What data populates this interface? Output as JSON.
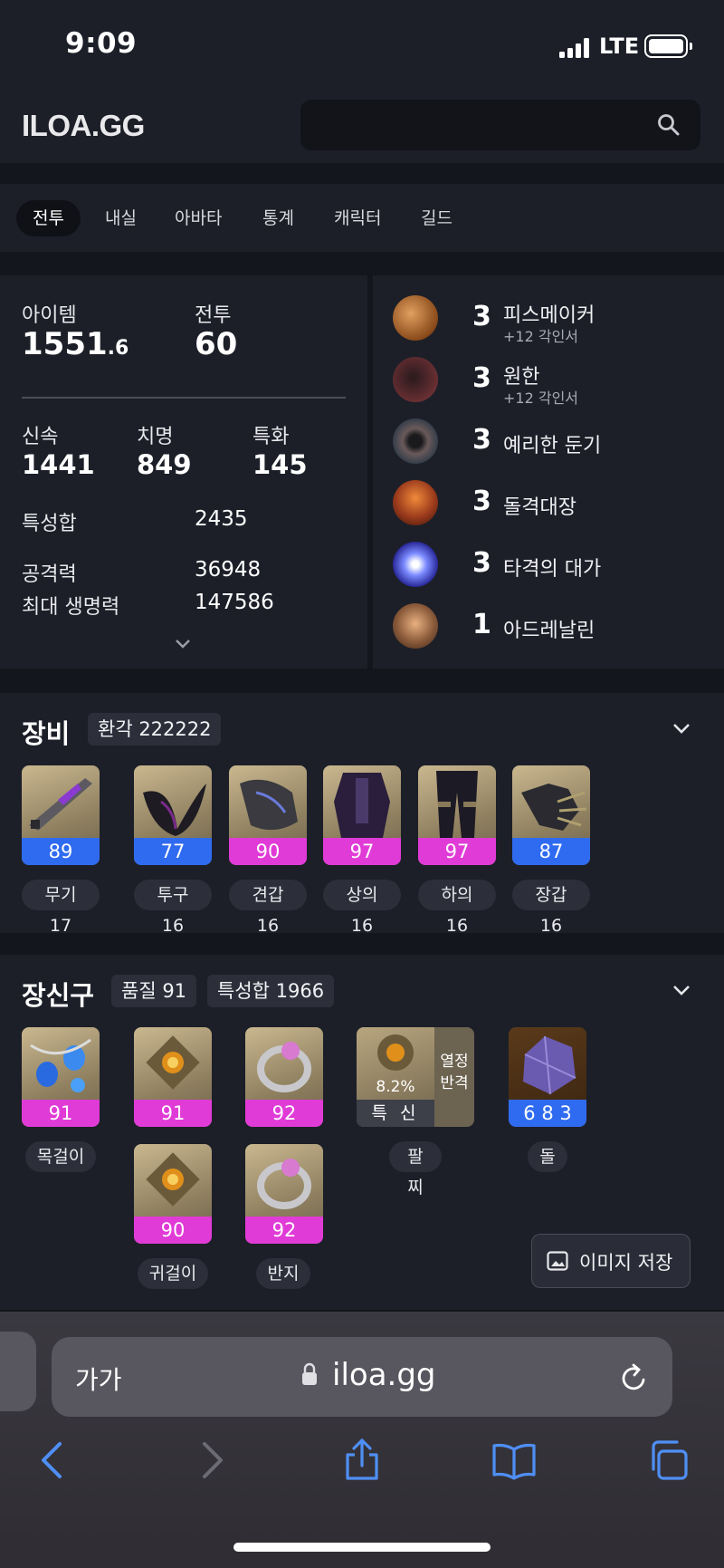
{
  "status": {
    "time": "9:09",
    "network": "LTE"
  },
  "header": {
    "logo": "ILOA.GG",
    "search_placeholder": ""
  },
  "tabs": [
    {
      "label": "전투",
      "active": true
    },
    {
      "label": "내실",
      "active": false
    },
    {
      "label": "아바타",
      "active": false
    },
    {
      "label": "통계",
      "active": false
    },
    {
      "label": "캐릭터",
      "active": false
    },
    {
      "label": "길드",
      "active": false
    }
  ],
  "profile": {
    "item_label": "아이템",
    "item_level_int": "1551",
    "item_level_dec": ".6",
    "combat_label": "전투",
    "combat_level": "60",
    "swift_label": "신속",
    "swift": "1441",
    "crit_label": "치명",
    "crit": "849",
    "spec_label": "특화",
    "spec": "145",
    "stat_total_label": "특성합",
    "stat_total": "2435",
    "attack_label": "공격력",
    "attack": "36948",
    "hp_label": "최대 생명력",
    "hp": "147586"
  },
  "engravings": [
    {
      "level": "3",
      "name": "피스메이커",
      "sub": "+12 각인서",
      "color": "#b86a2a"
    },
    {
      "level": "3",
      "name": "원한",
      "sub": "+12 각인서",
      "color": "#5a2a2e"
    },
    {
      "level": "3",
      "name": "예리한 둔기",
      "sub": "",
      "color": "#3e3a3c"
    },
    {
      "level": "3",
      "name": "돌격대장",
      "sub": "",
      "color": "#9a3a1c"
    },
    {
      "level": "3",
      "name": "타격의 대가",
      "sub": "",
      "color": "#4a52c8"
    },
    {
      "level": "1",
      "name": "아드레날린",
      "sub": "",
      "color": "#8a5a3a"
    }
  ],
  "equipment": {
    "title": "장비",
    "badge": "환각 222222",
    "items": [
      {
        "quality": "89",
        "tier": "blue",
        "label": "무기 17"
      },
      {
        "quality": "77",
        "tier": "blue",
        "label": "투구 16"
      },
      {
        "quality": "90",
        "tier": "pink",
        "label": "견갑 16"
      },
      {
        "quality": "97",
        "tier": "pink",
        "label": "상의 16"
      },
      {
        "quality": "97",
        "tier": "pink",
        "label": "하의 16"
      },
      {
        "quality": "87",
        "tier": "blue",
        "label": "장갑 16"
      }
    ]
  },
  "accessories": {
    "title": "장신구",
    "badge_quality": "품질 91",
    "badge_stat": "특성합 1966",
    "necklace": {
      "quality": "91",
      "label": "목걸이"
    },
    "earring1": {
      "quality": "91"
    },
    "ring1": {
      "quality": "92"
    },
    "earring2": {
      "quality": "90",
      "label": "귀걸이"
    },
    "ring2": {
      "quality": "92",
      "label": "반지"
    },
    "bracelet": {
      "pct": "8.2%",
      "stats": "특 신",
      "effect1": "열정",
      "effect2": "반격",
      "label": "팔찌"
    },
    "stone": {
      "value": "6 8 3",
      "label": "돌"
    }
  },
  "save_button": "이미지 저장",
  "browser": {
    "aa": "가가",
    "url": "iloa.gg"
  },
  "colors": {
    "blue": "#2f6bf0",
    "pink": "#e03bd6",
    "panel": "#1c1f28",
    "background": "#14161d"
  }
}
